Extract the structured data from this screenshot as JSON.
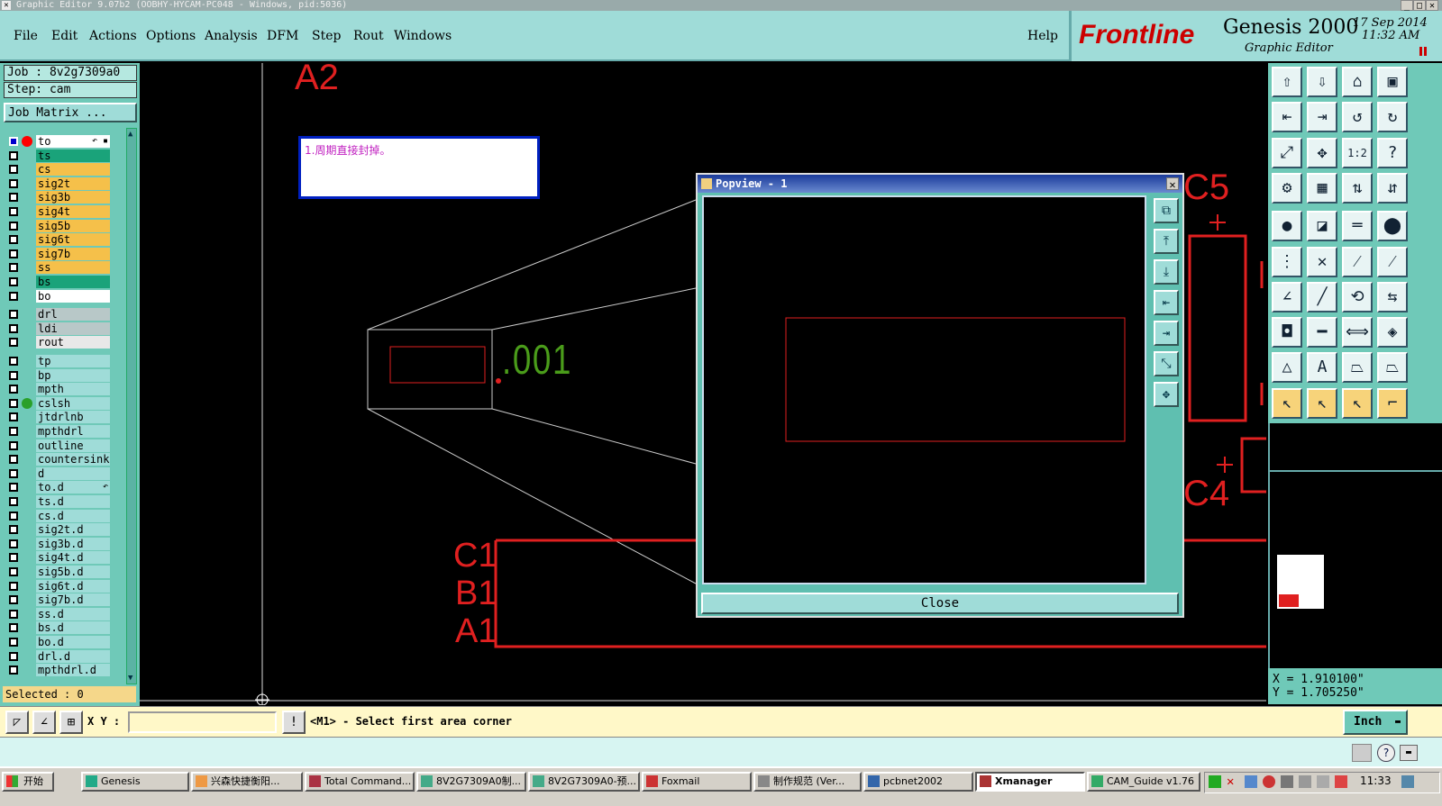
{
  "window": {
    "title": "Graphic Editor 9.07b2 (OOBHY-HYCAM-PC048 - Windows, pid:5036)"
  },
  "menu": {
    "file": "File",
    "edit": "Edit",
    "actions": "Actions",
    "options": "Options",
    "analysis": "Analysis",
    "dfm": "DFM",
    "step": "Step",
    "rout": "Rout",
    "windows": "Windows",
    "help": "Help"
  },
  "brand": {
    "logo": "Frontline",
    "product": "Genesis 2000",
    "subtitle": "Graphic Editor",
    "date": "17 Sep 2014",
    "time": "11:32 AM"
  },
  "job": {
    "job_label": "Job : 8v2g7309a0",
    "step_label": "Step: cam",
    "matrix_button": "Job Matrix ..."
  },
  "layers": [
    {
      "name": "to",
      "color": "#ffffff",
      "dot": "#ff0000",
      "selected": true,
      "icon": "↶ ▪"
    },
    {
      "name": "ts",
      "color": "#1aa37a"
    },
    {
      "name": "cs",
      "color": "#f5c04a"
    },
    {
      "name": "sig2t",
      "color": "#f5c04a"
    },
    {
      "name": "sig3b",
      "color": "#f5c04a"
    },
    {
      "name": "sig4t",
      "color": "#f5c04a"
    },
    {
      "name": "sig5b",
      "color": "#f5c04a"
    },
    {
      "name": "sig6t",
      "color": "#f5c04a"
    },
    {
      "name": "sig7b",
      "color": "#f5c04a"
    },
    {
      "name": "ss",
      "color": "#f5c04a"
    },
    {
      "name": "bs",
      "color": "#1aa37a"
    },
    {
      "name": "bo",
      "color": "#ffffff"
    },
    {
      "name": "drl",
      "color": "#b8c8c8"
    },
    {
      "name": "ldi",
      "color": "#b8c8c8"
    },
    {
      "name": "rout",
      "color": "#e8e8e8"
    },
    {
      "name": "tp",
      "color": "#9fdcd8"
    },
    {
      "name": "bp",
      "color": "#9fdcd8"
    },
    {
      "name": "mpth",
      "color": "#9fdcd8"
    },
    {
      "name": "cslsh",
      "color": "#9fdcd8",
      "dot": "#2aa02a"
    },
    {
      "name": "jtdrlnb",
      "color": "#9fdcd8"
    },
    {
      "name": "mpthdrl",
      "color": "#9fdcd8"
    },
    {
      "name": "outline",
      "color": "#9fdcd8"
    },
    {
      "name": "countersink",
      "color": "#9fdcd8"
    },
    {
      "name": "d",
      "color": "#9fdcd8"
    },
    {
      "name": "to.d",
      "color": "#9fdcd8",
      "icon": "↶"
    },
    {
      "name": "ts.d",
      "color": "#9fdcd8"
    },
    {
      "name": "cs.d",
      "color": "#9fdcd8"
    },
    {
      "name": "sig2t.d",
      "color": "#9fdcd8"
    },
    {
      "name": "sig3b.d",
      "color": "#9fdcd8"
    },
    {
      "name": "sig4t.d",
      "color": "#9fdcd8"
    },
    {
      "name": "sig5b.d",
      "color": "#9fdcd8"
    },
    {
      "name": "sig6t.d",
      "color": "#9fdcd8"
    },
    {
      "name": "sig7b.d",
      "color": "#9fdcd8"
    },
    {
      "name": "ss.d",
      "color": "#9fdcd8"
    },
    {
      "name": "bs.d",
      "color": "#9fdcd8"
    },
    {
      "name": "bo.d",
      "color": "#9fdcd8"
    },
    {
      "name": "drl.d",
      "color": "#9fdcd8"
    },
    {
      "name": "mpthdrl.d",
      "color": "#9fdcd8"
    }
  ],
  "selected_count": "Selected : 0",
  "canvas": {
    "label_a2": "A2",
    "label_c5": "C5",
    "label_c4": "C4",
    "label_c1": "C1",
    "label_b1": "B1",
    "label_a1": "A1",
    "dim_value": ".001",
    "note": "1.周期直接封掉。"
  },
  "popview": {
    "title": "Popview - 1",
    "close": "Close"
  },
  "coords": {
    "x": "X = 1.910100\"",
    "y": "Y = 1.705250\""
  },
  "cmd": {
    "xy_label": "X Y :",
    "xy_value": "",
    "prompt": "<M1> - Select first area corner",
    "units": "Inch"
  },
  "taskbar": {
    "start": "开始",
    "items": [
      "Genesis",
      "兴森快捷衡阳...",
      "Total Command...",
      "8V2G7309A0制...",
      "8V2G7309A0-预...",
      "Foxmail",
      "制作规范 (Ver...",
      "pcbnet2002",
      "Xmanager",
      "CAM_Guide v1.76"
    ],
    "clock": "11:33"
  }
}
